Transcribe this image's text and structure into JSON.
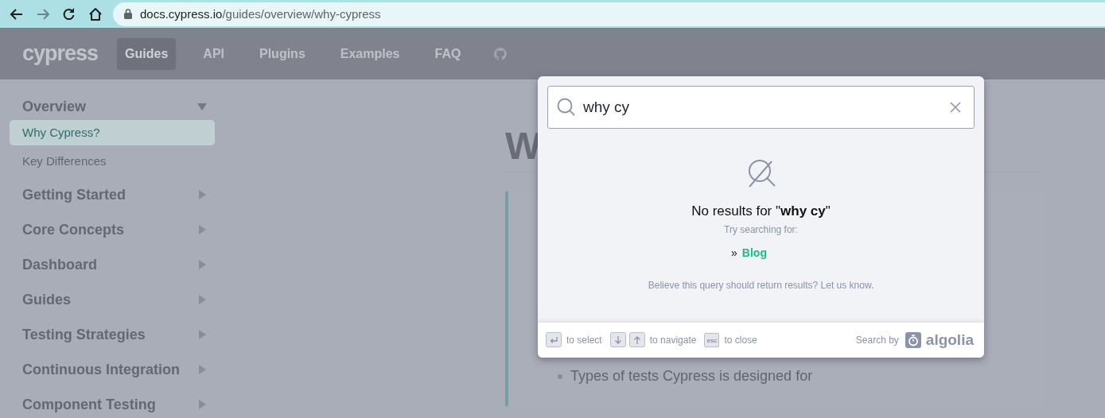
{
  "browser": {
    "back_disabled": false,
    "forward_disabled": true,
    "url_host": "docs.cypress.io",
    "url_path": "/guides/overview/why-cypress"
  },
  "nav": {
    "logo": "cypress",
    "items": [
      {
        "label": "Guides",
        "selected": true
      },
      {
        "label": "API",
        "selected": false
      },
      {
        "label": "Plugins",
        "selected": false
      },
      {
        "label": "Examples",
        "selected": false
      },
      {
        "label": "FAQ",
        "selected": false
      }
    ]
  },
  "sidebar": {
    "sections": [
      {
        "label": "Overview",
        "expanded": true,
        "children": [
          {
            "label": "Why Cypress?",
            "selected": true
          },
          {
            "label": "Key Differences",
            "selected": false
          }
        ]
      },
      {
        "label": "Getting Started",
        "expanded": false
      },
      {
        "label": "Core Concepts",
        "expanded": false
      },
      {
        "label": "Dashboard",
        "expanded": false
      },
      {
        "label": "Guides",
        "expanded": false
      },
      {
        "label": "Testing Strategies",
        "expanded": false
      },
      {
        "label": "Continuous Integration",
        "expanded": false
      },
      {
        "label": "Component Testing",
        "expanded": false
      }
    ]
  },
  "content": {
    "heading": "W",
    "bullet": "Types of tests Cypress is designed for"
  },
  "search_modal": {
    "query": "why cy",
    "no_results": "No results for \"**why cy**\"",
    "try_label": "Try searching for:",
    "suggestions": [
      {
        "marker": "»",
        "label": "Blog"
      }
    ],
    "feedback": "Believe this query should return results? Let us know.",
    "footer": {
      "hints": [
        {
          "keys": [
            {
              "kind": "enter"
            }
          ],
          "label": "to select"
        },
        {
          "keys": [
            {
              "kind": "down"
            },
            {
              "kind": "up"
            }
          ],
          "label": "to navigate"
        },
        {
          "keys": [
            {
              "kind": "text",
              "text": "esc"
            }
          ],
          "label": "to close"
        }
      ],
      "search_by": "Search by",
      "brand": "algolia"
    }
  }
}
